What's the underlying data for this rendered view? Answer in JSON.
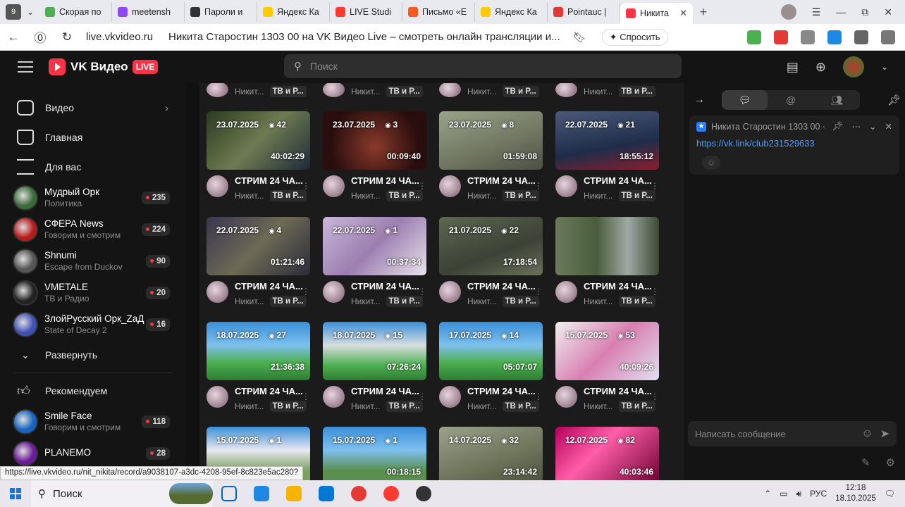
{
  "browser": {
    "tab_count": "9",
    "tabs": [
      {
        "label": "Скорая по",
        "color": "#4caf50"
      },
      {
        "label": "meetensh",
        "color": "#9146ff"
      },
      {
        "label": "Пароли и",
        "color": "#333333"
      },
      {
        "label": "Яндекс Ка",
        "color": "#ffcc00"
      },
      {
        "label": "LIVE Studi",
        "color": "#ff3b30"
      },
      {
        "label": "Письмо «Е",
        "color": "#ff5722"
      },
      {
        "label": "Яндекс Ка",
        "color": "#ffcc00"
      },
      {
        "label": "Pointauc |",
        "color": "#e53935"
      },
      {
        "label": "Никита",
        "color": "#ff3347",
        "active": true
      }
    ],
    "url_domain": "live.vkvideo.ru",
    "page_title": "Никита Старостин 1303 00 на VK Видео Live – смотреть онлайн трансляции и...",
    "ask_button": "Спросить",
    "status_url": "https://live.vkvideo.ru/nit_nikita/record/a9038107-a3dc-4208-95ef-8c823e5ac280?"
  },
  "header": {
    "logo_text": "VK Видео",
    "live_badge": "LIVE",
    "search_placeholder": "Поиск"
  },
  "sidebar": {
    "nav": [
      {
        "label": "Видео"
      },
      {
        "label": "Главная"
      },
      {
        "label": "Для вас"
      }
    ],
    "channels": [
      {
        "name": "Мудрый Орк",
        "sub": "Политика",
        "count": "235",
        "color": "#3a6b3a"
      },
      {
        "name": "СФЕРА News",
        "sub": "Говорим и смотрим",
        "count": "224",
        "color": "#b71c1c"
      },
      {
        "name": "Shnumi",
        "sub": "Escape from Duckov",
        "count": "90",
        "color": "#555555"
      },
      {
        "name": "VMETALE",
        "sub": "ТВ и Радио",
        "count": "20",
        "color": "#222222"
      },
      {
        "name": "ЗлойРусский Орк_ZaД",
        "sub": "State of Decay 2",
        "count": "16",
        "color": "#3f51b5"
      }
    ],
    "expand_label": "Развернуть",
    "recommend_label": "Рекомендуем",
    "recommended": [
      {
        "name": "Smile Face",
        "sub": "Говорим и смотрим",
        "count": "118",
        "color": "#1565c0"
      },
      {
        "name": "PLANEMO",
        "sub": "",
        "count": "28",
        "color": "#6a1b9a"
      }
    ]
  },
  "videos": {
    "top_row": [
      {
        "channel": "Никит...",
        "tag": "ТВ и Р..."
      },
      {
        "channel": "Никит...",
        "tag": "ТВ и Р..."
      },
      {
        "channel": "Никит...",
        "tag": "ТВ и Р..."
      },
      {
        "channel": "Никит...",
        "tag": "ТВ и Р..."
      }
    ],
    "items": [
      {
        "date": "23.07.2025",
        "views": "42",
        "duration": "40:02:29",
        "title": "СТРИМ 24 ЧА...",
        "channel": "Никит...",
        "tag": "ТВ и Р...",
        "bg": "linear-gradient(135deg,#2b3a1f,#6e7b52 50%,#1d2a3a)"
      },
      {
        "date": "23.07.2025",
        "views": "3",
        "duration": "00:09:40",
        "title": "СТРИМ 24 ЧА...",
        "channel": "Никит...",
        "tag": "ТВ и Р...",
        "bg": "radial-gradient(circle at 50% 60%,#8a3a2a,#2a0e0e 70%)"
      },
      {
        "date": "23.07.2025",
        "views": "8",
        "duration": "01:59:08",
        "title": "СТРИМ 24 ЧА...",
        "channel": "Никит...",
        "tag": "ТВ и Р...",
        "bg": "linear-gradient(160deg,#9aa38a,#6f7560 60%,#4b5043)"
      },
      {
        "date": "22.07.2025",
        "views": "21",
        "duration": "18:55:12",
        "title": "СТРИМ 24 ЧА...",
        "channel": "Никит...",
        "tag": "ТВ и Р...",
        "bg": "linear-gradient(170deg,#4a5a78,#1f2d4a 60%,#8a1e2e)"
      },
      {
        "date": "22.07.2025",
        "views": "4",
        "duration": "01:21:46",
        "title": "СТРИМ 24 ЧА...",
        "channel": "Никит...",
        "tag": "ТВ и Р...",
        "bg": "linear-gradient(135deg,#3a3550,#6d6a55 50%,#2c2b3a)"
      },
      {
        "date": "22.07.2025",
        "views": "1",
        "duration": "00:37:34",
        "title": "СТРИМ 24 ЧА...",
        "channel": "Никит...",
        "tag": "ТВ и Р...",
        "bg": "linear-gradient(135deg,#c9b8d9,#9b7eb0 50%,#e8e3ec)"
      },
      {
        "date": "21.07.2025",
        "views": "22",
        "duration": "17:18:54",
        "title": "СТРИМ 24 ЧА...",
        "channel": "Никит...",
        "tag": "ТВ и Р...",
        "bg": "linear-gradient(160deg,#5e6650,#3c4235 60%,#6b705c)"
      },
      {
        "date": "",
        "views": "",
        "duration": "",
        "title": "СТРИМ 24 ЧА...",
        "channel": "Никит...",
        "tag": "ТВ и Р...",
        "bg": "linear-gradient(90deg,#6a7a5a,#4a5d3c 40%,#a0a8a4 70%,#3a4a33)"
      },
      {
        "date": "18.07.2025",
        "views": "27",
        "duration": "21:36:38",
        "title": "СТРИМ 24 ЧА...",
        "channel": "Никит...",
        "tag": "ТВ и Р...",
        "bg": "linear-gradient(180deg,#3a8fd8 0%,#7ec0ee 40%,#4caf50 70%,#2e7d32)"
      },
      {
        "date": "18.07.2025",
        "views": "15",
        "duration": "07:26:24",
        "title": "СТРИМ 24 ЧА...",
        "channel": "Никит...",
        "tag": "ТВ и Р...",
        "bg": "linear-gradient(180deg,#3a8fd8 0%,#d8dde0 40%,#4caf50 75%,#2e7d32)"
      },
      {
        "date": "17.07.2025",
        "views": "14",
        "duration": "05:07:07",
        "title": "СТРИМ 24 ЧА...",
        "channel": "Никит...",
        "tag": "ТВ и Р...",
        "bg": "linear-gradient(180deg,#3a8fd8 0%,#7ec0ee 40%,#4caf50 70%,#2e7d32)"
      },
      {
        "date": "15.07.2025",
        "views": "53",
        "duration": "40:09:26",
        "title": "СТРИМ 24 ЧА...",
        "channel": "Никит...",
        "tag": "ТВ и Р...",
        "bg": "linear-gradient(135deg,#f0f0f0,#d87fb0 50%,#e0e0f0)"
      },
      {
        "date": "15.07.2025",
        "views": "1",
        "duration": "",
        "title": "",
        "channel": "",
        "tag": "",
        "bg": "linear-gradient(180deg,#3a8fd8 0%,#e8e8f0 40%,#7da060 75%)"
      },
      {
        "date": "15.07.2025",
        "views": "1",
        "duration": "00:18:15",
        "title": "",
        "channel": "",
        "tag": "",
        "bg": "linear-gradient(180deg,#3a8fd8 0%,#7ec0ee 40%,#5a8f50 75%)"
      },
      {
        "date": "14.07.2025",
        "views": "32",
        "duration": "23:14:42",
        "title": "",
        "channel": "",
        "tag": "",
        "bg": "linear-gradient(160deg,#9ca08a,#6c7358 60%,#4a4f3c)"
      },
      {
        "date": "12.07.2025",
        "views": "82",
        "duration": "40:03:46",
        "title": "",
        "channel": "",
        "tag": "",
        "bg": "linear-gradient(135deg,#b5005c,#ff5ea8 40%,#6a0030)"
      }
    ]
  },
  "chat": {
    "pinned_author": "Никита Старостин 1303 00 ·",
    "pinned_link": "https://vk.link/club231529633",
    "input_placeholder": "Написать сообщение"
  },
  "taskbar": {
    "search_label": "Поиск",
    "lang": "РУС",
    "time": "12:18",
    "date": "18.10.2025",
    "apps": [
      "#0067c0",
      "#1e88e5",
      "#f4b400",
      "#0078d4",
      "#e53935",
      "#ff3b30",
      "#333333"
    ]
  }
}
